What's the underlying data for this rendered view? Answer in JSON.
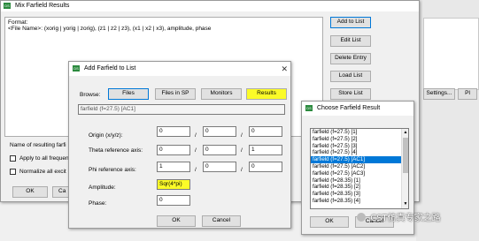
{
  "mix_dialog": {
    "title": "Mix Farfield Results",
    "format_line1": "Format:",
    "format_line2": "<File Name>: (xorig | yorig | zorig), (z1 | z2 | z3), (x1 | x2 | x3), amplitude, phase",
    "buttons": [
      "Add to List",
      "Edit List",
      "Delete Entry",
      "Load List",
      "Store List"
    ],
    "result_name_label": "Name of resulting farfi",
    "apply_freq_label": "Apply to all frequen",
    "normalize_label": "Normalize all excit",
    "ok_label": "OK",
    "cancel_label": "Ca"
  },
  "bg_right": {
    "tab1": "Settings...",
    "tab2": "Pl"
  },
  "add_dialog": {
    "title": "Add Farfield to List",
    "browse_label": "Browse:",
    "browse_buttons": [
      "Files",
      "Files in SP",
      "Monitors",
      "Results"
    ],
    "selected_file": "farfield (f=27.5) [AC1]",
    "origin_label": "Origin (x/y/z):",
    "origin_values": [
      "0",
      "0",
      "0"
    ],
    "theta_label": "Theta reference axis:",
    "theta_values": [
      "0",
      "0",
      "1"
    ],
    "phi_label": "Phi reference axis:",
    "phi_values": [
      "1",
      "0",
      "0"
    ],
    "separator": "/",
    "amplitude_label": "Amplitude:",
    "amplitude_value": "Sqr(4*pi)",
    "phase_label": "Phase:",
    "phase_value": "0",
    "ok_label": "OK",
    "cancel_label": "Cancel"
  },
  "choose_dialog": {
    "title": "Choose Farfield Result",
    "items": [
      "farfield (f=27.5) [1]",
      "farfield (f=27.5) [2]",
      "farfield (f=27.5) [3]",
      "farfield (f=27.5) [4]",
      "farfield (f=27.5) [AC1]",
      "farfield (f=27.5) [AC2]",
      "farfield (f=27.5) [AC3]",
      "farfield (f=28.35) [1]",
      "farfield (f=28.35) [2]",
      "farfield (f=28.35) [3]",
      "farfield (f=28.35) [4]"
    ],
    "selected_index": 4,
    "ok_label": "OK",
    "cancel_label": "Cancel"
  },
  "watermark": "CST仿真专家之路",
  "colors": {
    "selection": "#0078d7",
    "highlight": "#fbfb28",
    "accent_border": "#0078d7"
  },
  "icons": [
    "app-icon",
    "close-icon",
    "chevron-up-icon",
    "chevron-down-icon",
    "wechat-icon"
  ]
}
